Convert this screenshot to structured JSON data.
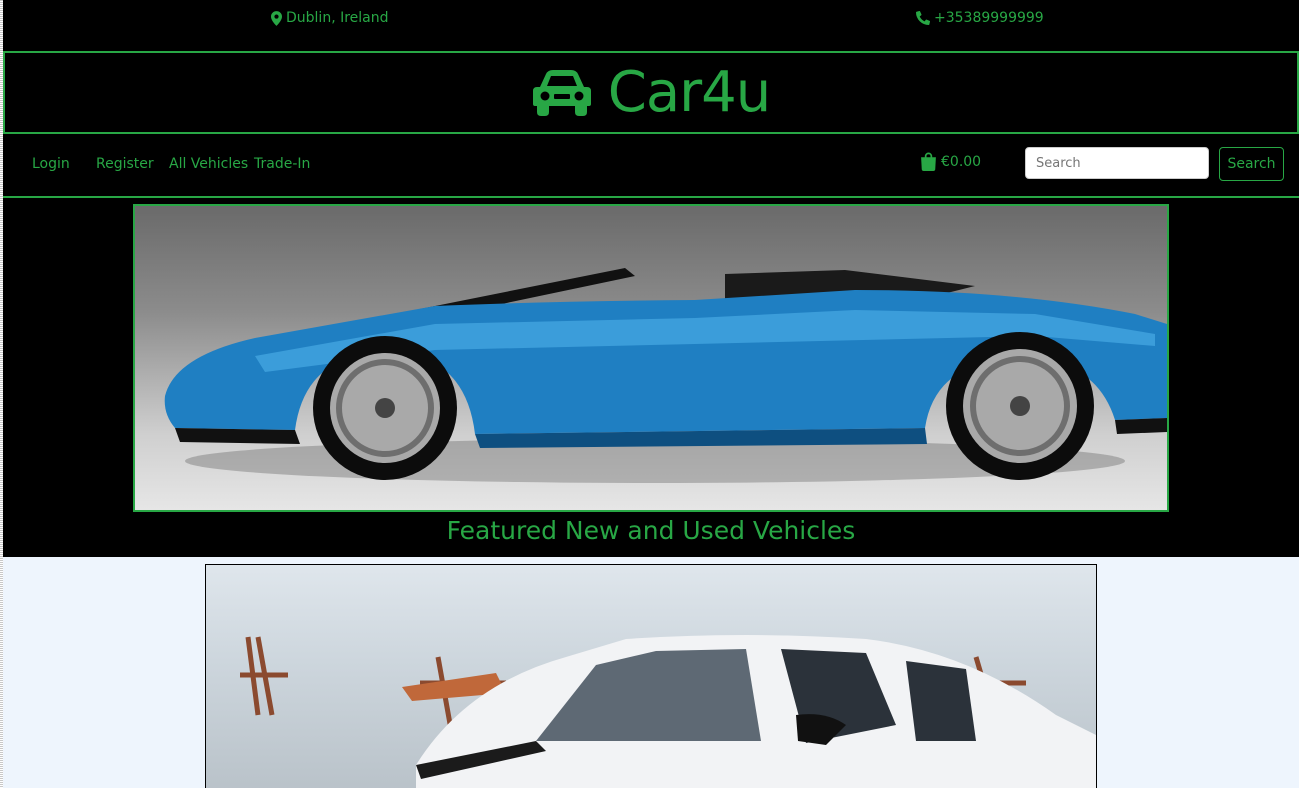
{
  "topbar": {
    "location": "Dublin, Ireland",
    "phone": "+35389999999",
    "location_icon": "map-marker-icon",
    "phone_icon": "phone-icon"
  },
  "brand": {
    "name": "Car4u",
    "icon": "car-icon"
  },
  "nav": {
    "login": "Login",
    "register": "Register",
    "all_vehicles": "All Vehicles",
    "trade_in": "Trade-In"
  },
  "cart": {
    "total": "€0.00",
    "icon": "shopping-bag-icon"
  },
  "search": {
    "placeholder": "Search",
    "button": "Search"
  },
  "featured": {
    "heading": "Featured New and Used Vehicles"
  },
  "colors": {
    "accent": "#28a745",
    "background": "#000000",
    "lower_background": "#eef5fd"
  }
}
